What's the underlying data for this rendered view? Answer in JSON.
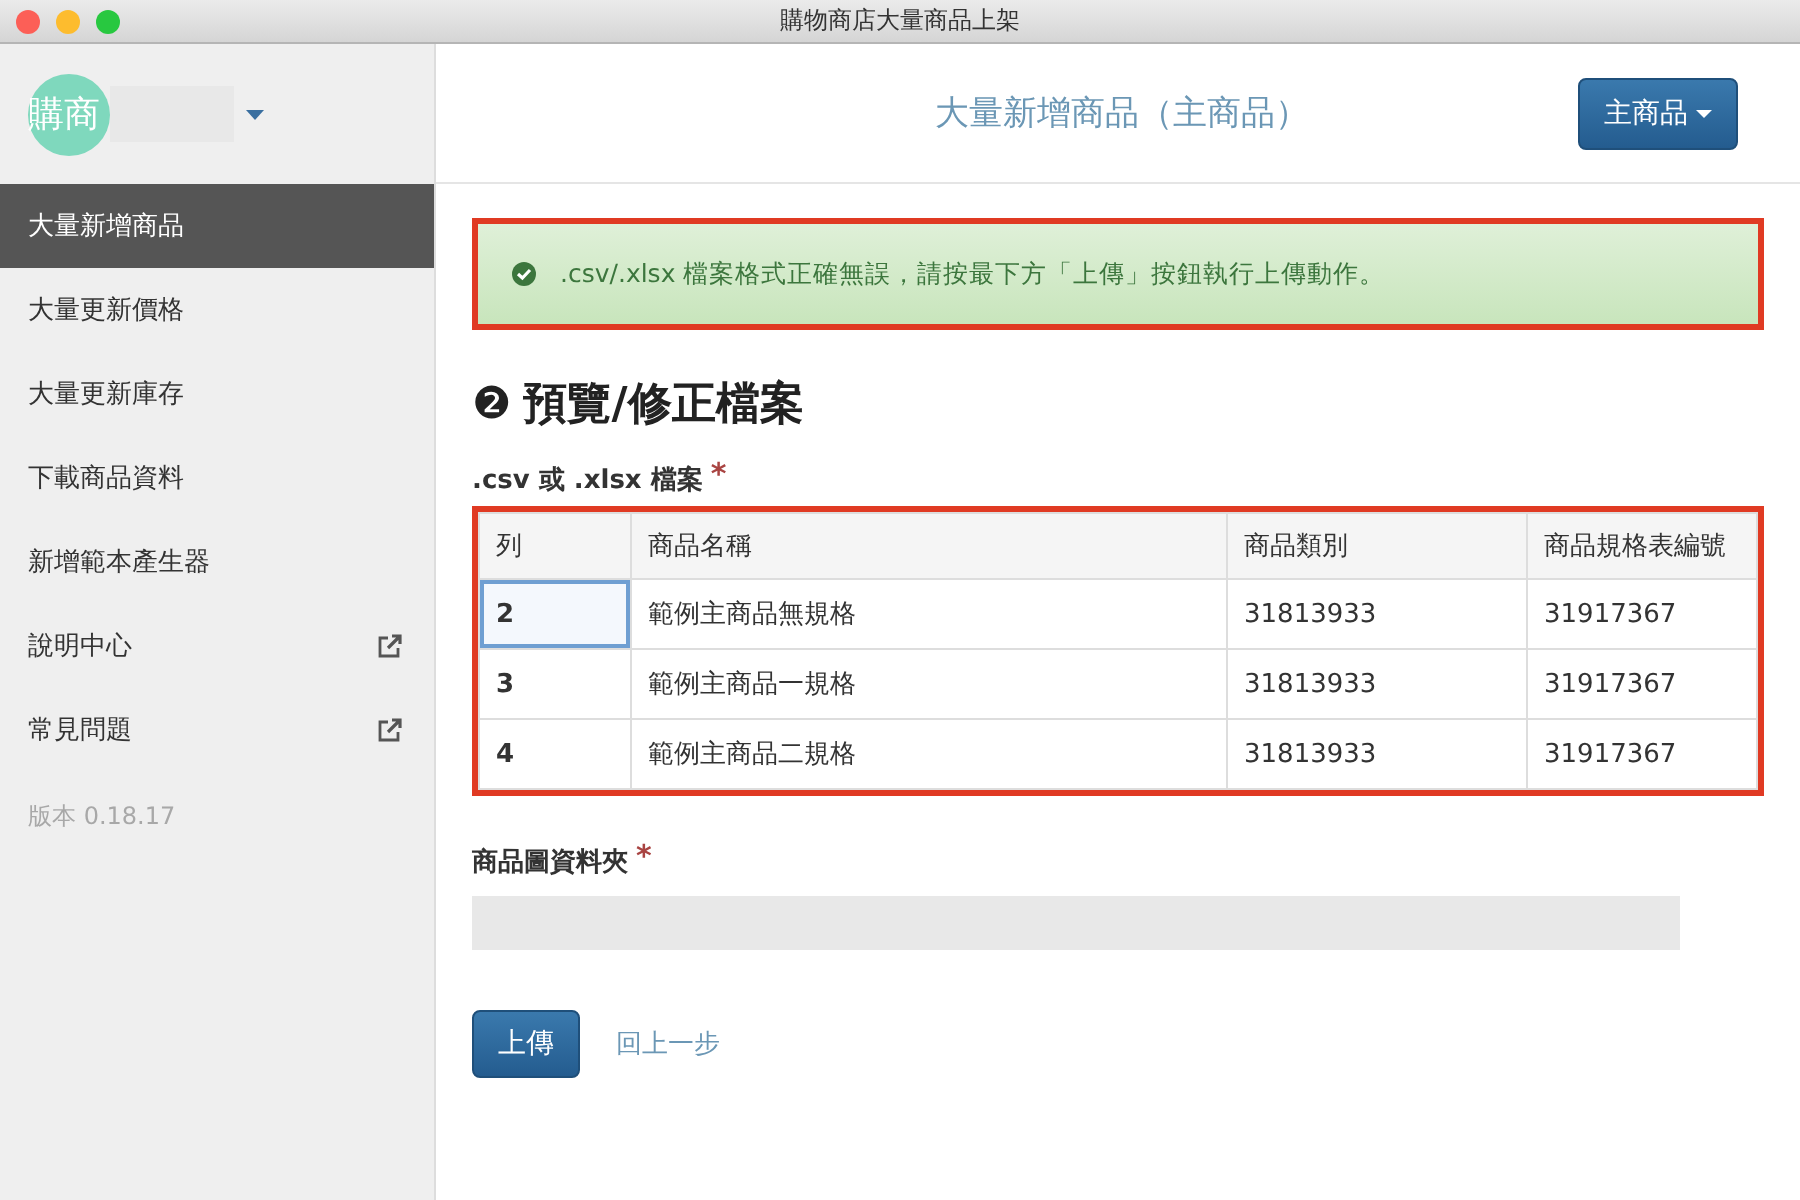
{
  "window": {
    "title": "購物商店大量商品上架"
  },
  "account": {
    "avatar_text": "購商"
  },
  "sidebar": {
    "items": [
      {
        "label": "大量新增商品",
        "selected": true,
        "external": false
      },
      {
        "label": "大量更新價格",
        "selected": false,
        "external": false
      },
      {
        "label": "大量更新庫存",
        "selected": false,
        "external": false
      },
      {
        "label": "下載商品資料",
        "selected": false,
        "external": false
      },
      {
        "label": "新增範本產生器",
        "selected": false,
        "external": false
      },
      {
        "label": "說明中心",
        "selected": false,
        "external": true
      },
      {
        "label": "常見問題",
        "selected": false,
        "external": true
      }
    ],
    "version": "版本 0.18.17"
  },
  "header": {
    "title": "大量新增商品（主商品）",
    "menu_button": "主商品"
  },
  "alert": {
    "message": ".csv/.xlsx 檔案格式正確無誤，請按最下方「上傳」按鈕執行上傳動作。"
  },
  "section": {
    "step": "❷",
    "title": "預覽/修正檔案"
  },
  "file_label": ".csv 或 .xlsx 檔案",
  "required_mark": "*",
  "table": {
    "columns": [
      "列",
      "商品名稱",
      "商品類別",
      "商品規格表編號"
    ],
    "rows": [
      {
        "cells": [
          "2",
          "範例主商品無規格",
          "31813933",
          "31917367"
        ],
        "selected": true
      },
      {
        "cells": [
          "3",
          "範例主商品一規格",
          "31813933",
          "31917367"
        ],
        "selected": false
      },
      {
        "cells": [
          "4",
          "範例主商品二規格",
          "31813933",
          "31917367"
        ],
        "selected": false
      }
    ]
  },
  "folder_label": "商品圖資料夾",
  "buttons": {
    "upload": "上傳",
    "back": "回上一步"
  }
}
